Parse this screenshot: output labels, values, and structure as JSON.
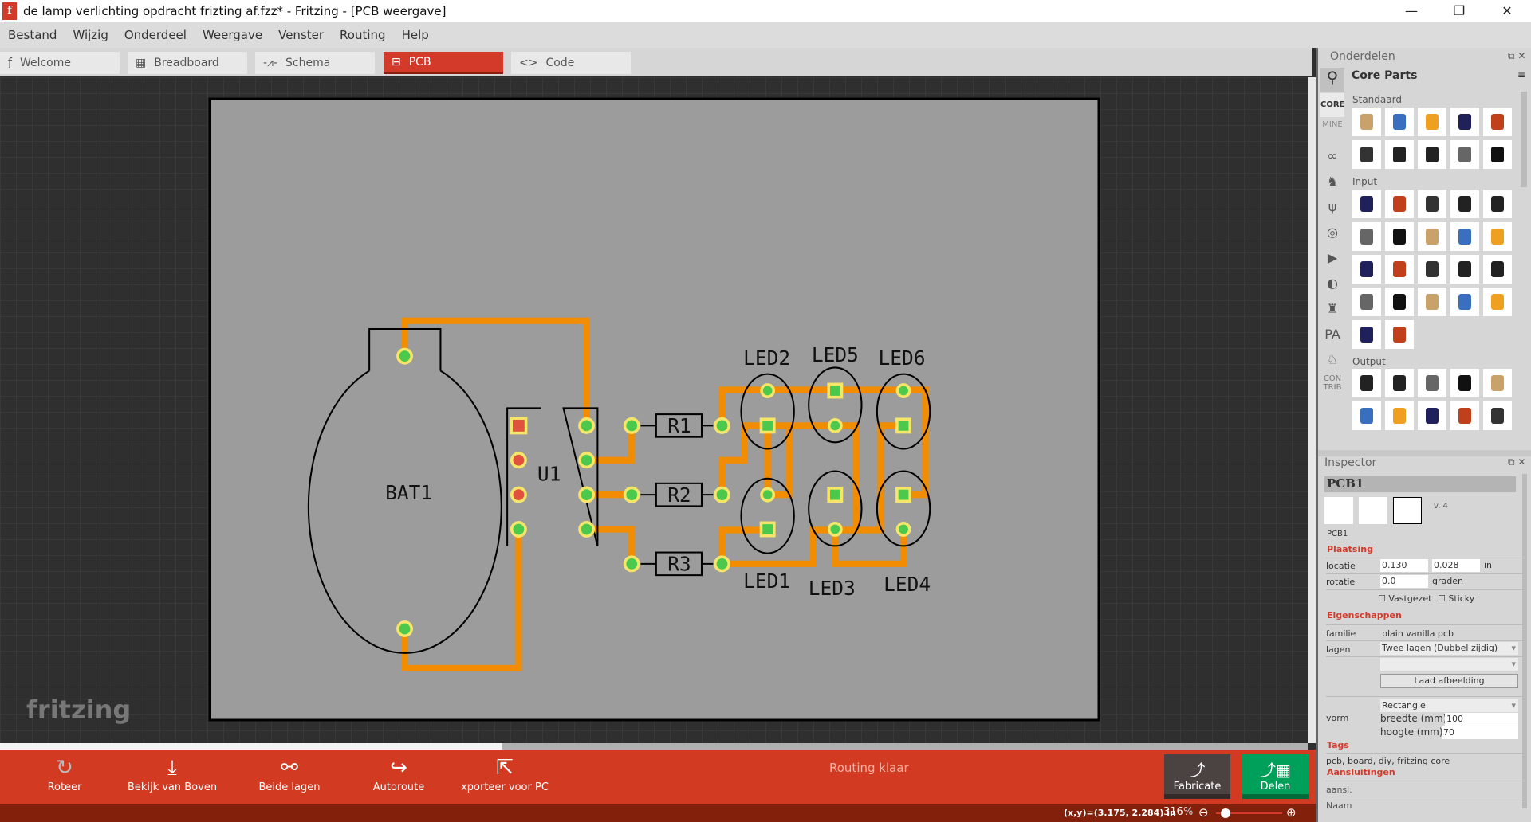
{
  "window": {
    "title": "de lamp verlichting opdracht frizting af.fzz* - Fritzing - [PCB weergave]",
    "logo": "f",
    "minimize": "—",
    "maximize": "❐",
    "close": "✕"
  },
  "menu": [
    "Bestand",
    "Wijzig",
    "Onderdeel",
    "Weergave",
    "Venster",
    "Routing",
    "Help"
  ],
  "tabs": [
    {
      "label": "Welcome",
      "icon": "fritzing-icon"
    },
    {
      "label": "Breadboard",
      "icon": "breadboard-icon"
    },
    {
      "label": "Schema",
      "icon": "schematic-icon"
    },
    {
      "label": "PCB",
      "icon": "pcb-icon",
      "active": true
    },
    {
      "label": "Code",
      "icon": "code-icon"
    }
  ],
  "canvas": {
    "watermark": "fritzing",
    "labels": {
      "bat": "BAT1",
      "u1": "U1",
      "r1": "R1",
      "r2": "R2",
      "r3": "R3",
      "led1": "LED1",
      "led2": "LED2",
      "led3": "LED3",
      "led4": "LED4",
      "led5": "LED5",
      "led6": "LED6"
    }
  },
  "toolbar": {
    "buttons": [
      "Roteer",
      "Bekijk van Boven",
      "Beide lagen",
      "Autoroute",
      "xporteer voor PC"
    ],
    "routing_status": "Routing klaar",
    "fabricate": "Fabricate",
    "share": "Delen"
  },
  "status": {
    "coords": "(x,y)=(3.175, 2.284) in",
    "zoom": "316",
    "zoom_unit": "%",
    "zoom_level": 0.3
  },
  "parts": {
    "title": "Onderdelen",
    "bin_title": "Core Parts",
    "bins": [
      "CORE",
      "MINE",
      "CON TRIB"
    ],
    "sections": [
      {
        "name": "Standaard",
        "count": 10
      },
      {
        "name": "Input",
        "count": 22
      },
      {
        "name": "Output",
        "count": 10
      }
    ]
  },
  "inspector": {
    "title": "Inspector",
    "part": "PCB1",
    "version": "v. 4",
    "label": "PCB1",
    "placement": "Plaatsing",
    "location_label": "locatie",
    "loc_x": "0.130",
    "loc_y": "0.028",
    "loc_unit": "in",
    "rotation_label": "rotatie",
    "rotation": "0.0",
    "rotation_unit": "graden",
    "locked": "Vastgezet",
    "sticky": "Sticky",
    "properties": "Eigenschappen",
    "family_label": "familie",
    "family": "plain vanilla pcb",
    "layers_label": "lagen",
    "layers": "Twee lagen (Dubbel zijdig)",
    "load_image": "Laad afbeelding",
    "shape_label": "vorm",
    "shape": "Rectangle",
    "width_label": "breedte (mm)",
    "width": "100",
    "height_label": "hoogte (mm)",
    "height": "70",
    "tags_title": "Tags",
    "tags": "pcb, board, diy, fritzing core",
    "connections": "Aansluitingen",
    "conn_label": "aansl.",
    "name_label": "Naam"
  }
}
